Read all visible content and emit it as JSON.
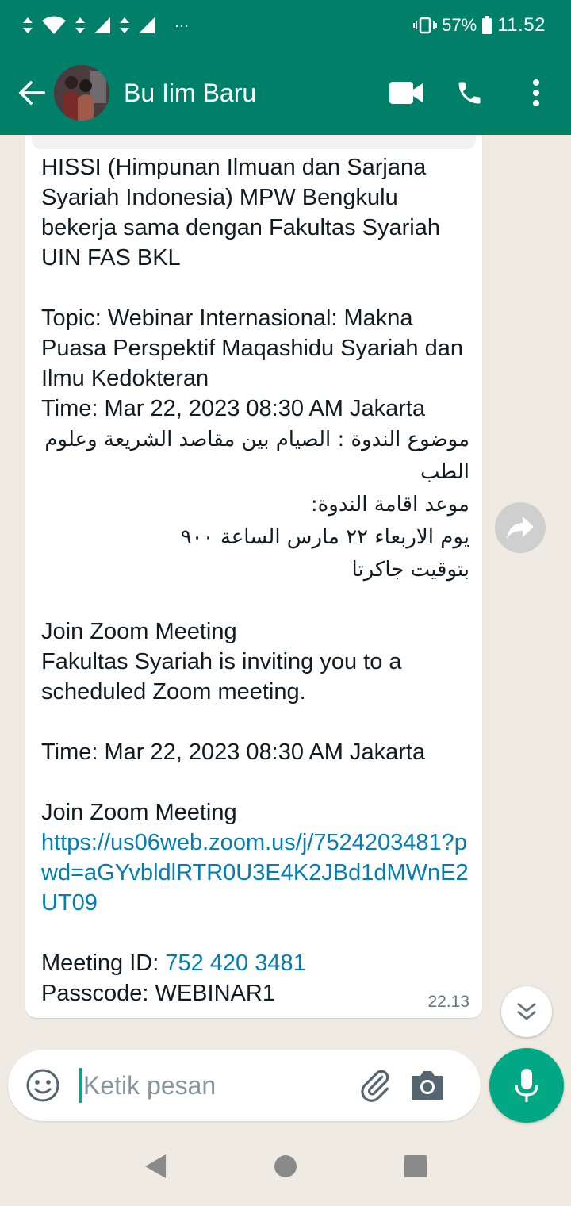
{
  "status_bar": {
    "battery": "57%",
    "time": "11.52",
    "more": "···"
  },
  "header": {
    "contact_name": "Bu Iim Baru"
  },
  "message": {
    "paragraph_1": "HISSI (Himpunan Ilmuan dan Sarjana Syariah Indonesia) MPW Bengkulu bekerja sama dengan Fakultas Syariah UIN FAS BKL",
    "paragraph_2": "Topic: Webinar Internasional: Makna Puasa Perspektif Maqashidu Syariah dan Ilmu Kedokteran\nTime: Mar 22, 2023 08:30 AM Jakarta",
    "arabic": "موضوع الندوة : الصيام بين مقاصد الشريعة وعلوم الطب\nموعد اقامة الندوة:\nيوم الاربعاء ٢٢ مارس الساعة ٩٠٠\nبتوقيت جاكرتا",
    "paragraph_3": "Join Zoom Meeting\nFakultas Syariah is inviting you to a scheduled Zoom meeting.",
    "time_line": "Time: Mar 22, 2023 08:30 AM Jakarta",
    "join_label": "Join Zoom Meeting",
    "zoom_link": "https://us06web.zoom.us/j/7524203481?pwd=aGYvbldlRTR0U3E4K2JBd1dMWnE2UT09",
    "meeting_id_label": "Meeting ID: ",
    "meeting_id": "752 420 3481",
    "passcode": "Passcode: WEBINAR1",
    "timestamp": "22.13"
  },
  "composer": {
    "placeholder": "Ketik pesan"
  },
  "colors": {
    "header": "#008069",
    "accent": "#00a884",
    "link": "#027eb5",
    "chat_bg": "#efeae2"
  }
}
